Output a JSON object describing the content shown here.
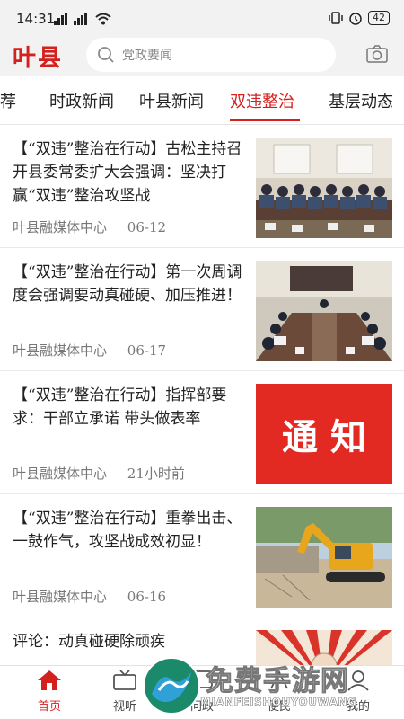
{
  "status_bar": {
    "time": "14:31",
    "signal_text": "5G",
    "battery": "42"
  },
  "header": {
    "logo": "叶县",
    "search_placeholder": "党政要闻"
  },
  "tabs": [
    {
      "label": "推荐"
    },
    {
      "label": "时政新闻"
    },
    {
      "label": "叶县新闻"
    },
    {
      "label": "双违整治",
      "active": true
    },
    {
      "label": "基层动态"
    }
  ],
  "articles": [
    {
      "title": "【“双违”整治在行动】古松主持召开县委常委扩大会强调：坚决打赢“双违”整治攻坚战",
      "source": "叶县融媒体中心",
      "time": "06-12",
      "thumb": "meeting-photo"
    },
    {
      "title": "【“双违”整治在行动】第一次周调度会强调要动真碰硬、加压推进！",
      "source": "叶县融媒体中心",
      "time": "06-17",
      "thumb": "conference-photo"
    },
    {
      "title": "【“双违”整治在行动】指挥部要求：干部立承诺 带头做表率",
      "source": "叶县融媒体中心",
      "time": "21小时前",
      "thumb_text": "通 知"
    },
    {
      "title": "【“双违”整治在行动】重拳出击、一鼓作气，攻坚战成效初显！",
      "source": "叶县融媒体中心",
      "time": "06-16",
      "thumb": "excavator-photo"
    },
    {
      "title": "评论：动真碰硬除顽疾",
      "thumb": "rays-photo"
    }
  ],
  "bottom_nav": [
    {
      "label": "首页",
      "icon": "home-icon",
      "active": true
    },
    {
      "label": "视听",
      "icon": "tv-icon"
    },
    {
      "label": "问政",
      "icon": "question-icon"
    },
    {
      "label": "便民",
      "icon": "service-icon"
    },
    {
      "label": "我的",
      "icon": "user-icon"
    }
  ],
  "watermark": {
    "text": "免费手游网",
    "sub": "MIANFEISHOUYOUWANG"
  },
  "colors": {
    "accent": "#d5211e",
    "notice_bg": "#e22a22"
  }
}
